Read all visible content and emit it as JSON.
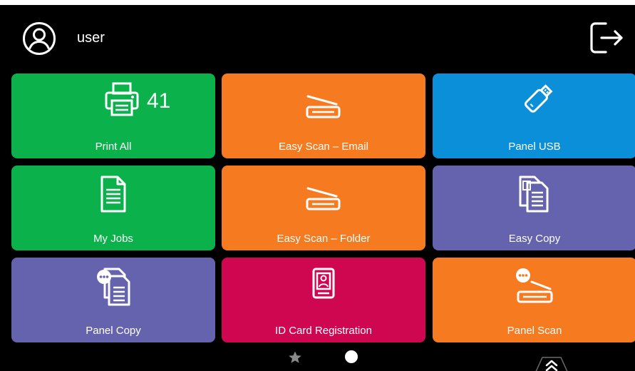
{
  "header": {
    "username": "user",
    "icons": {
      "avatar": "user-circle-icon",
      "logout": "logout-icon"
    }
  },
  "tiles": [
    {
      "label": "Print All",
      "icon": "printer-icon",
      "badge": "41",
      "color": "#0bb14b"
    },
    {
      "label": "Easy Scan – Email",
      "icon": "scanner-icon",
      "color": "#f57a20"
    },
    {
      "label": "Panel USB",
      "icon": "usb-icon",
      "color": "#0a8fd8"
    },
    {
      "label": "My Jobs",
      "icon": "document-icon",
      "color": "#0bb14b"
    },
    {
      "label": "Easy Scan – Folder",
      "icon": "scanner-icon",
      "color": "#f57a20"
    },
    {
      "label": "Easy Copy",
      "icon": "copy-documents-icon",
      "color": "#6563ad"
    },
    {
      "label": "Panel Copy",
      "icon": "panel-copy-icon",
      "color": "#6563ad"
    },
    {
      "label": "ID Card Registration",
      "icon": "id-card-icon",
      "color": "#cf0650"
    },
    {
      "label": "Panel Scan",
      "icon": "panel-scan-icon",
      "color": "#f57a20"
    }
  ],
  "pager": {
    "icons": {
      "favorites": "star-icon",
      "page": "page-dot-icon",
      "expand": "chevron-up-double-icon"
    }
  }
}
